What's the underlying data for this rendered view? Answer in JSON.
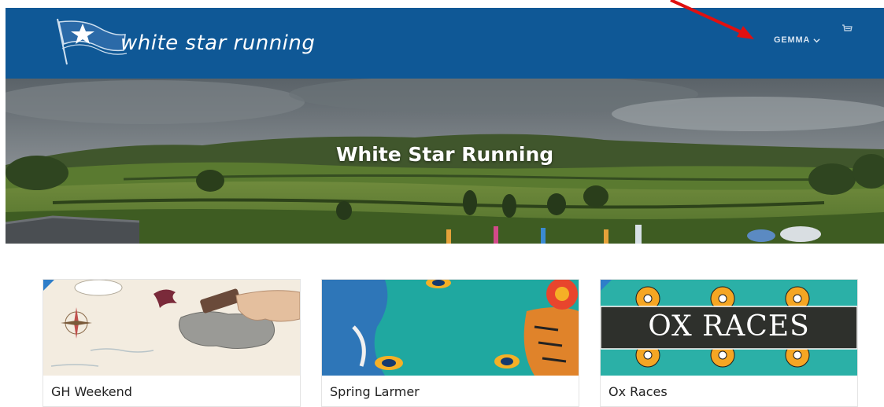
{
  "header": {
    "brand": "white star running",
    "user_label": "GEMMA",
    "user_chevron_icon": "chevron-down-icon",
    "cart_icon": "cart-icon"
  },
  "hero": {
    "title": "White Star Running"
  },
  "events": [
    {
      "name": "GH Weekend"
    },
    {
      "name": "Spring Larmer"
    },
    {
      "name": "Ox Races",
      "banner": "OX RACES"
    }
  ],
  "colors": {
    "header_bg": "#0f5896",
    "annotation_arrow": "#e01010"
  }
}
